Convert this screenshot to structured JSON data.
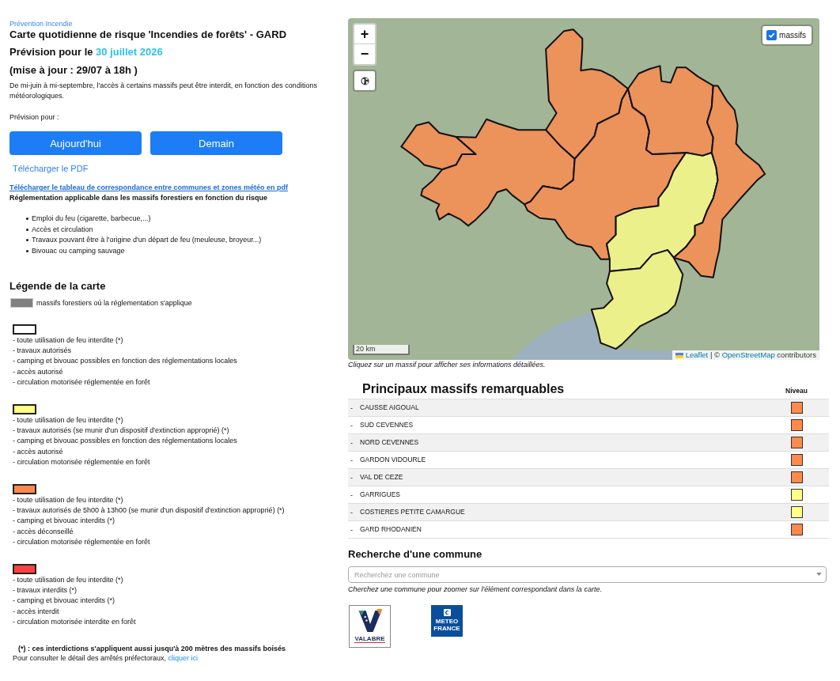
{
  "header": {
    "breadcrumb": "Prévention Incendie",
    "title": "Carte quotidienne de risque 'Incendies de forêts' - GARD",
    "forecast": {
      "prefix": "Prévision pour le",
      "date": "30 juillet 2026"
    },
    "update": "(mise à jour : 29/07 à 18h )",
    "intro": "De mi-juin à mi-septembre, l'accès à certains massifs peut être interdit, en fonction des conditions météorologiques."
  },
  "forecast_choice": {
    "label": "Prévision pour :",
    "buttons": [
      "Aujourd'hui",
      "Demain"
    ]
  },
  "downloads": {
    "pdf": "Télécharger le PDF",
    "correspondence": "Télécharger le tableau de correspondance entre communes et zones météo en pdf"
  },
  "regulation": {
    "title": "Réglementation applicable dans les massifs forestiers en fonction du risque",
    "items": [
      "Emploi du feu (cigarette, barbecue,...)",
      "Accès et circulation",
      "Travaux pouvant être à l'origine d'un départ de feu (meuleuse, broyeur...)",
      "Bivouac ou camping sauvage"
    ]
  },
  "legend": {
    "title": "Légende de la carte",
    "forest": {
      "label": "massifs forestiers où la réglementation s'applique",
      "color": "#808080"
    },
    "levels": [
      {
        "color": "#ffffff",
        "lines": [
          "- toute utilisation de feu interdite (*)",
          "- travaux autorisés",
          "- camping et bivouac possibles en fonction des réglementations locales",
          "- accès autorisé",
          "- circulation motorisée réglementée en forêt"
        ]
      },
      {
        "color": "#ffff80",
        "lines": [
          "- toute utilisation de feu interdite (*)",
          "- travaux autorisés (se munir d'un dispositif d'extinction approprié) (*)",
          "- camping et bivouac possibles en fonction des réglementations locales",
          "- accès autorisé",
          "- circulation motorisée réglementée en forêt"
        ]
      },
      {
        "color": "#ff8a4c",
        "lines": [
          "- toute utilisation de feu interdite (*)",
          "- travaux autorisés de 5h00 à 13h00 (se munir d'un dispositif d'extinction approprié) (*)",
          "- camping et bivouac interdits (*)",
          "- accès déconseillé",
          "- circulation motorisée réglementée en forêt"
        ]
      },
      {
        "color": "#ff4040",
        "lines": [
          "- toute utilisation de feu interdite (*)",
          "- travaux interdits (*)",
          "- camping et bivouac interdits (*)",
          "- accès interdit",
          "- circulation motorisée interdite en forêt"
        ]
      }
    ]
  },
  "footnote": "(*) : ces interdictions s'appliquent aussi jusqu'à 200 mètres des massifs boisés",
  "decrees": {
    "text": "Pour consulter le détail des arrêtés préfectoraux,",
    "link": "cliquer ici"
  },
  "map": {
    "zoom_in": "+",
    "zoom_out": "−",
    "layer_toggle": {
      "label": "massifs",
      "checked": true
    },
    "scale": "20 km",
    "attribution": {
      "leaflet": "Leaflet",
      "separator": "| ©",
      "osm": "OpenStreetMap",
      "suffix": "contributors"
    },
    "caption": "Cliquez sur un massif pour afficher ses informations détaillées."
  },
  "massifs": {
    "title": "Principaux massifs remarquables",
    "level_header": "Niveau",
    "rows": [
      {
        "marker": "-",
        "name": "CAUSSE AIGOUAL",
        "color": "#ff8a4c"
      },
      {
        "marker": "-",
        "name": "SUD CEVENNES",
        "color": "#ff8a4c"
      },
      {
        "marker": "-",
        "name": "NORD CEVENNES",
        "color": "#ff8a4c"
      },
      {
        "marker": "-",
        "name": "GARDON VIDOURLE",
        "color": "#ff8a4c"
      },
      {
        "marker": "-",
        "name": "VAL DE CEZE",
        "color": "#ff8a4c"
      },
      {
        "marker": "-",
        "name": "GARRIGUES",
        "color": "#ffff88"
      },
      {
        "marker": "-",
        "name": "COSTIERES PETITE CAMARGUE",
        "color": "#ffff88"
      },
      {
        "marker": "-",
        "name": "GARD RHODANIEN",
        "color": "#ff8a4c"
      }
    ]
  },
  "commune_search": {
    "title": "Recherche d'une commune",
    "placeholder": "Recherchez une commune",
    "help": "Cherchez une commune pour zoomer sur l'élément correspondant dans la carte."
  },
  "logos": [
    {
      "kind": "valabre",
      "lines": [
        "VALABRE"
      ]
    },
    {
      "kind": "meteo",
      "lines": [
        "METEO",
        "FRANCE"
      ]
    }
  ]
}
